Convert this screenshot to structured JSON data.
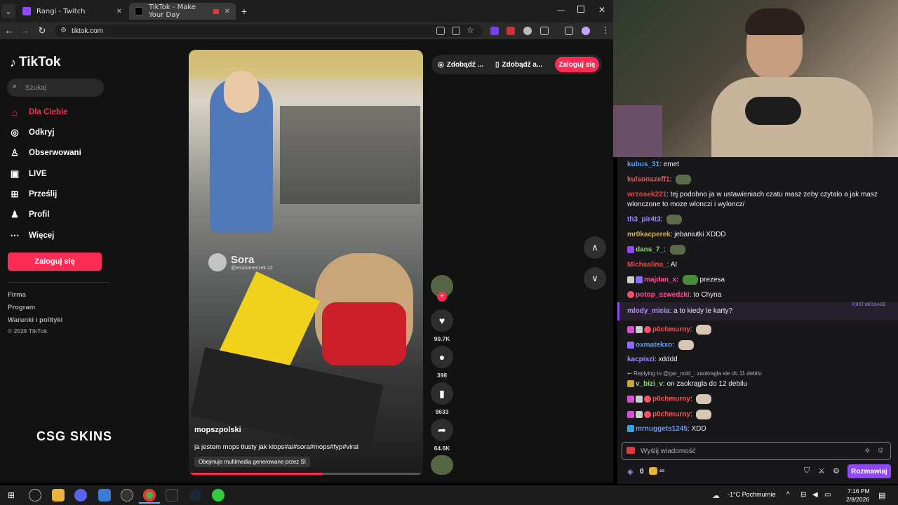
{
  "browser": {
    "tabs": [
      {
        "title": "Rangi - Twitch",
        "active": false
      },
      {
        "title": "TikTok - Make Your Day",
        "active": true
      }
    ],
    "url": "tiktok.com"
  },
  "tiktok": {
    "logo": "TikTok",
    "search_placeholder": "Szukaj",
    "nav": [
      {
        "label": "Dla Ciebie",
        "icon": "home-icon",
        "active": true
      },
      {
        "label": "Odkryj",
        "icon": "compass-icon",
        "active": false
      },
      {
        "label": "Obserwowani",
        "icon": "following-icon",
        "active": false
      },
      {
        "label": "LIVE",
        "icon": "live-icon",
        "active": false
      },
      {
        "label": "Prześlij",
        "icon": "upload-icon",
        "active": false
      },
      {
        "label": "Profil",
        "icon": "profile-icon",
        "active": false
      },
      {
        "label": "Więcej",
        "icon": "more-icon",
        "active": false
      }
    ],
    "login_button": "Zaloguj się",
    "footer": [
      "Firma",
      "Program",
      "Warunki i polityki"
    ],
    "copyright": "© 2026 TikTok",
    "sponsor": "CSG SKINS",
    "top_pills": [
      "Zdobądź ...",
      "Zdobądź a..."
    ],
    "top_login": "Zaloguj się",
    "video": {
      "watermark": "Sora",
      "watermark_handle": "@tenziomeczek.12",
      "author": "mopszpolski",
      "caption": "ja jestem mops tłusty jak klops#ai#sora#mops#fyp#viral",
      "ai_label": "Obejmuje multimedia generowane przez SI"
    },
    "actions": [
      {
        "icon": "heart-icon",
        "count": "90.7K"
      },
      {
        "icon": "comment-icon",
        "count": "398"
      },
      {
        "icon": "bookmark-icon",
        "count": "9633"
      },
      {
        "icon": "share-icon",
        "count": "64.6K"
      }
    ]
  },
  "chat": {
    "messages": [
      {
        "user": "kubus_31",
        "color": "#5b9bff",
        "text": "emet",
        "emote": false
      },
      {
        "user": "kulsonszeff1",
        "color": "#ff4f4f",
        "text": "",
        "emote": true
      },
      {
        "user": "wrzosek221",
        "color": "#ff3b3b",
        "text": "tej podobno ja w ustawieniach czatu masz zeby czytalo a jak masz",
        "emote": false
      },
      {
        "user": "",
        "color": "#efeff1",
        "text": "wlonczone to moze wlonczi i wyloncz/",
        "emote": false
      },
      {
        "user": "th3_pir4t3",
        "color": "#9a8cff",
        "text": "",
        "emote": true
      },
      {
        "user": "mr0kacperek",
        "color": "#d6b24a",
        "text": "jebaniutki XDDD",
        "emote": false
      },
      {
        "user": "dans_7_",
        "color": "#7ddf64",
        "text": "",
        "emote": true
      },
      {
        "user": "Michaalina_",
        "color": "#ff3b3b",
        "text": "AI",
        "emote": false
      },
      {
        "user": "majdan_x",
        "color": "#ff4f9a",
        "text": "prezesa",
        "emote": true
      },
      {
        "user": "potop_szwedzki",
        "color": "#ff4f9a",
        "text": "to Chyna",
        "emote": false
      },
      {
        "user": "mlody_micia",
        "color": "#b48cff",
        "text": "a to kiedy te karty?",
        "emote": false
      },
      {
        "user": "p0chmurny",
        "color": "#ff4f4f",
        "text": "",
        "emote": true
      },
      {
        "user": "oxmatekxo",
        "color": "#5b9bff",
        "text": "",
        "emote": true
      },
      {
        "user": "kacpiszi",
        "color": "#9a8cff",
        "text": "xdddd",
        "emote": false
      },
      {
        "user": "v_bizi_v",
        "color": "#7ddf64",
        "text": "on zaokrągla do 12 debilu",
        "emote": false
      },
      {
        "user": "p0chmurny",
        "color": "#ff4f4f",
        "text": "",
        "emote": true
      },
      {
        "user": "p0chmurny",
        "color": "#ff4f4f",
        "text": "",
        "emote": true
      },
      {
        "user": "mrnuggets1245",
        "color": "#5b9bff",
        "text": "XDD",
        "emote": false
      }
    ],
    "first_message_label": "FIRST MESSAGE",
    "reply_note": "Replying to @gar_nold_: zaokragla sie do 11 debilu",
    "input_placeholder": "Wyślij wiadomość",
    "points": "0",
    "points_suffix": "∞",
    "send_button": "Rozmawiaj"
  },
  "taskbar": {
    "weather": "-1°C  Pochmurnie",
    "time": "7:16 PM",
    "date": "2/8/2026"
  }
}
